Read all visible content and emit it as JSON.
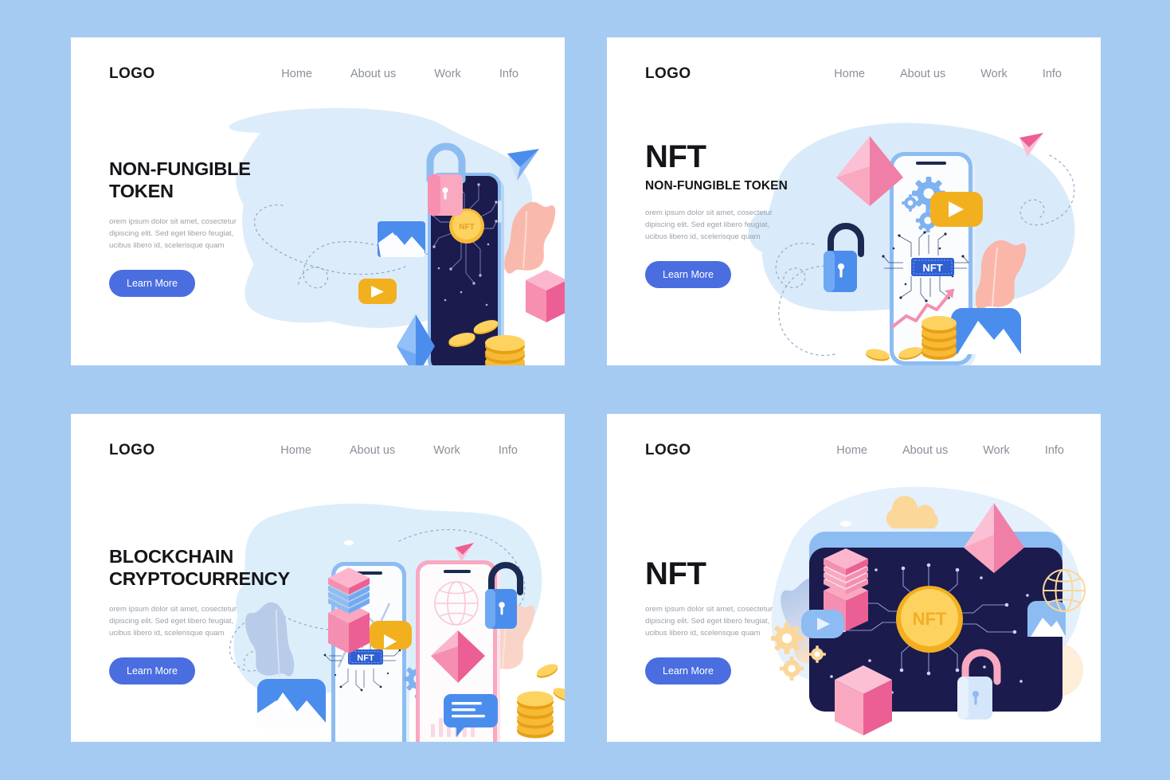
{
  "page": {
    "background_color": "#a6cbf2",
    "card_background": "#ffffff",
    "accent_button_color": "#4a6ee0",
    "nav_text_color": "#8a8f98",
    "heading_color": "#141519",
    "body_text_color": "#9ba1a9"
  },
  "nav": {
    "logo": "LOGO",
    "links": [
      {
        "label": "Home"
      },
      {
        "label": "About us"
      },
      {
        "label": "Work"
      },
      {
        "label": "Info"
      }
    ]
  },
  "shared": {
    "body_text": "orem ipsum dolor sit amet, cosectetur dipiscing elit. Sed eget libero feugiat, ucibus libero id, scelerisque quam",
    "cta_label": "Learn More",
    "nft_label": "NFT"
  },
  "cards": [
    {
      "id": "card-non-fungible-token",
      "heading_style": "mid",
      "heading": "NON-FUNGIBLE TOKEN",
      "heading_line1": "NON-FUNGIBLE",
      "heading_line2": "TOKEN",
      "subheading": "",
      "body_text": "orem ipsum dolor sit amet, cosectetur dipiscing elit. Sed eget libero feugiat, ucibus libero id, scelerisque quam",
      "cta_label": "Learn More",
      "illustration": {
        "name": "dark-phone-nft-coin",
        "blob_color": "#ddecfa",
        "phone_screen_color": "#1b1b4d",
        "elements": [
          "pink-padlock-icon",
          "paper-plane-icon",
          "image-mountain-icon",
          "play-button-icon",
          "blue-diamond-icon",
          "pink-cube-icon",
          "gold-coin-stack-icon",
          "nft-coin-icon",
          "peach-leaf-icon",
          "dotted-path"
        ]
      }
    },
    {
      "id": "card-nft-token",
      "heading_style": "big-with-sub",
      "heading": "NFT",
      "subheading": "NON-FUNGIBLE TOKEN",
      "body_text": "orem ipsum dolor sit amet, cosectetur dipiscing elit. Sed eget libero feugiat, ucibus libero id, scelerisque quam",
      "cta_label": "Learn More",
      "illustration": {
        "name": "white-phone-nft-chip",
        "blob_color": "#d9ebfa",
        "phone_screen_color": "#fafcfe",
        "elements": [
          "pink-diamond-icon",
          "gear-icon",
          "play-button-icon",
          "nft-chip-icon",
          "blue-padlock-icon",
          "paper-plane-icon",
          "peach-leaf-icon",
          "gold-coin-stack-icon",
          "image-mountain-icon",
          "growth-arrow-icon",
          "dotted-path"
        ]
      }
    },
    {
      "id": "card-blockchain-cryptocurrency",
      "heading_style": "mid",
      "heading": "BLOCKCHAIN CRYPTOCURRENCY",
      "heading_line1": "BLOCKCHAIN",
      "heading_line2": "CRYPTOCURRENCY",
      "subheading": "",
      "body_text": "orem ipsum dolor sit amet, cosectetur dipiscing elit. Sed eget libero feugiat, ucibus libero id, scelerisque quam",
      "cta_label": "Learn More",
      "illustration": {
        "name": "two-phones-blockchain",
        "blob_color": "#ddeefb",
        "elements": [
          "nft-chip-icon",
          "play-button-icon",
          "gear-icon",
          "chat-bubble-icon",
          "pink-diamond-icon",
          "globe-icon",
          "blue-padlock-icon",
          "server-stack-icon",
          "gold-coin-stack-icon",
          "image-mountain-icon",
          "bar-chart-icon",
          "paper-plane-icon",
          "leaf-icon",
          "dotted-path"
        ]
      }
    },
    {
      "id": "card-nft-wallet",
      "heading_style": "big",
      "heading": "NFT",
      "subheading": "",
      "body_text": "orem ipsum dolor sit amet, cosectetur dipiscing elit. Sed eget libero feugiat, ucibus libero id, scelerisque quam",
      "cta_label": "Learn More",
      "illustration": {
        "name": "dark-wallet-nft-coin",
        "blob_color": "#e4f0fb",
        "panel_color": "#1b1b4d",
        "elements": [
          "nft-coin-icon",
          "pink-diamond-icon",
          "pink-cube-icon",
          "server-stack-icon",
          "play-button-icon",
          "image-mountain-icon",
          "padlock-icon",
          "gear-icon",
          "globe-icon",
          "cloud-icon",
          "leaf-icon"
        ]
      }
    }
  ]
}
